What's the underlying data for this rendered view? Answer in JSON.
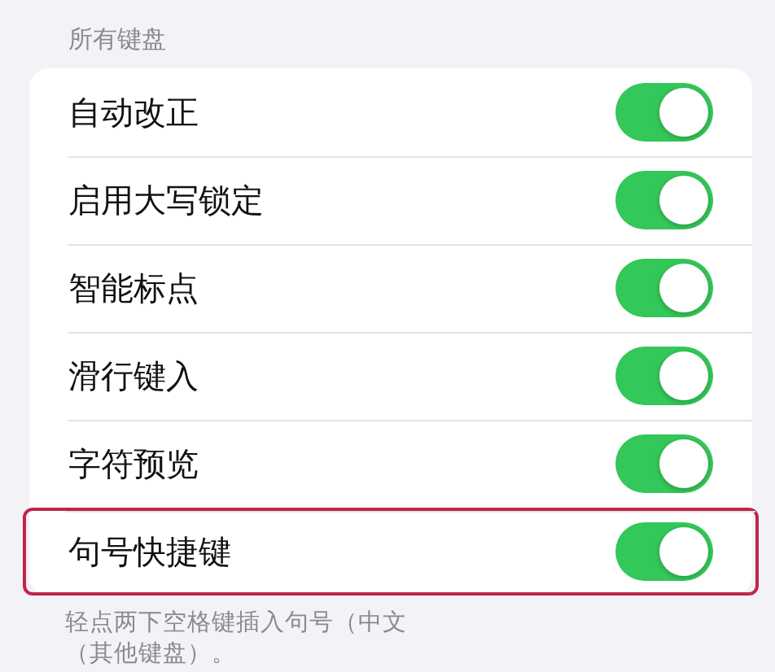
{
  "section_header": "所有键盘",
  "rows": [
    {
      "label": "自动改正",
      "on": true,
      "highlighted": false
    },
    {
      "label": "启用大写锁定",
      "on": true,
      "highlighted": false
    },
    {
      "label": "智能标点",
      "on": true,
      "highlighted": false
    },
    {
      "label": "滑行键入",
      "on": true,
      "highlighted": false
    },
    {
      "label": "字符预览",
      "on": true,
      "highlighted": false
    },
    {
      "label": "句号快捷键",
      "on": true,
      "highlighted": true
    }
  ],
  "footer": [
    "轻点两下空格键插入句号（中文",
    "（其他键盘）。"
  ]
}
